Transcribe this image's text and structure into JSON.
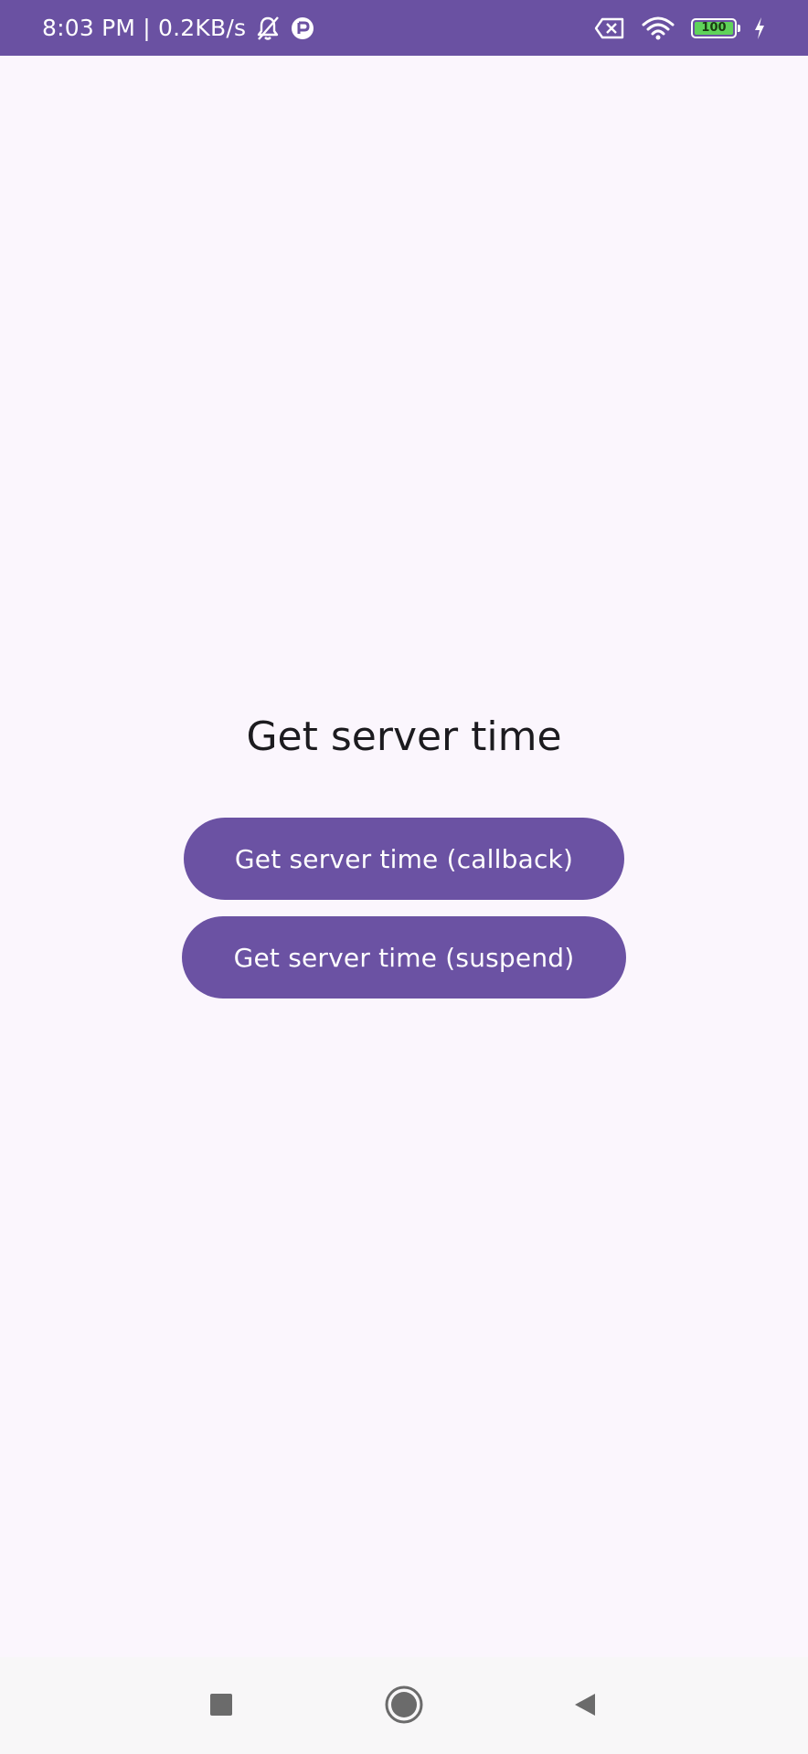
{
  "status_bar": {
    "time_network": "8:03 PM | 0.2KB/s",
    "battery_level": "100",
    "icons": [
      "mute-bell-icon",
      "app-notification-icon",
      "no-sim-icon",
      "wifi-icon",
      "battery-icon",
      "charging-bolt-icon"
    ]
  },
  "main": {
    "title": "Get server time",
    "buttons": [
      {
        "label": "Get server time (callback)"
      },
      {
        "label": "Get server time (suspend)"
      }
    ]
  },
  "nav_bar": {
    "icons": [
      "recents-square-icon",
      "home-circle-icon",
      "back-triangle-icon"
    ]
  },
  "colors": {
    "status_bar_bg": "#6a51a2",
    "background": "#fbf6fd",
    "button_bg": "#6b52a3",
    "button_text": "#ffffff",
    "title_text": "#1c1b1f",
    "battery_fill": "#5fd35a"
  }
}
